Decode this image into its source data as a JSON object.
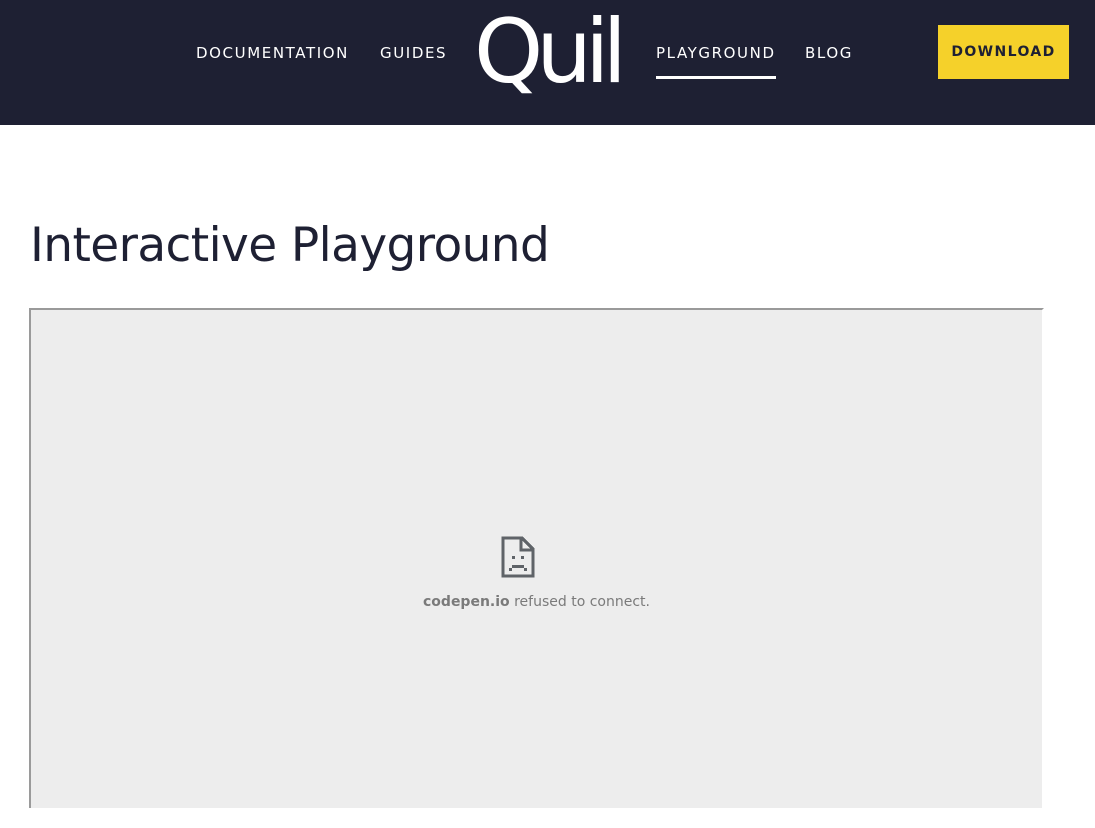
{
  "header": {
    "nav_left": [
      "DOCUMENTATION",
      "GUIDES"
    ],
    "logo_text": "Quill",
    "nav_right": [
      "PLAYGROUND",
      "BLOG"
    ],
    "active_item": "PLAYGROUND",
    "download_label": "DOWNLOAD"
  },
  "main": {
    "title": "Interactive Playground",
    "embed": {
      "icon": "sad-document-icon",
      "host": "codepen.io",
      "message": " refused to connect."
    }
  },
  "colors": {
    "navbar_bg": "#1e2033",
    "accent_yellow": "#f5d12a",
    "frame_bg": "#ededed",
    "error_text": "#7a7a7a"
  }
}
